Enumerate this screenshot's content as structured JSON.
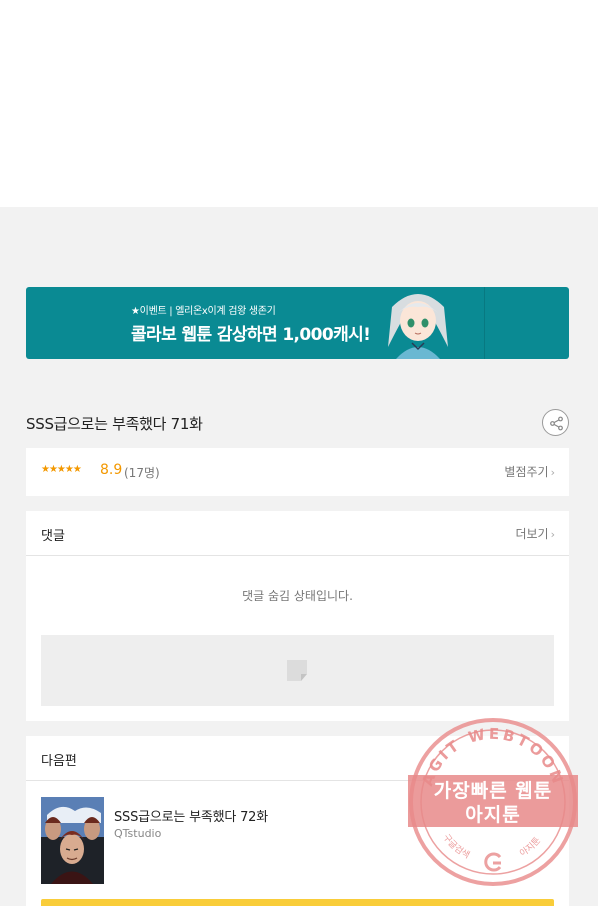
{
  "banner": {
    "small_text": "★이벤트 | 엘리온x이계 검왕 생존기",
    "big_text": "콜라보 웹툰 감상하면 1,000캐시!"
  },
  "episode": {
    "title": "SSS급으로는 부족했다 71화",
    "share_icon": "share-icon"
  },
  "rating": {
    "stars": "★★★★★",
    "score": "8.9",
    "count": "(17명)",
    "rate_label": "별점주기"
  },
  "comments": {
    "title": "댓글",
    "more_label": "더보기",
    "hidden_message": "댓글 숨김 상태입니다."
  },
  "next_episode": {
    "header": "다음편",
    "title": "SSS급으로는 부족했다 72화",
    "studio": "QTstudio"
  },
  "watermark": {
    "arc_text": "AGIT WEBTOON",
    "line1": "가장빠른 웹툰",
    "line2": "아지툰",
    "bottom_left": "구글검색",
    "bottom_right": "아지툰",
    "color": "#e88a8a"
  },
  "colors": {
    "banner_bg": "#0a8a93",
    "rating_orange": "#f39800",
    "button_yellow": "#f9cd3a"
  }
}
